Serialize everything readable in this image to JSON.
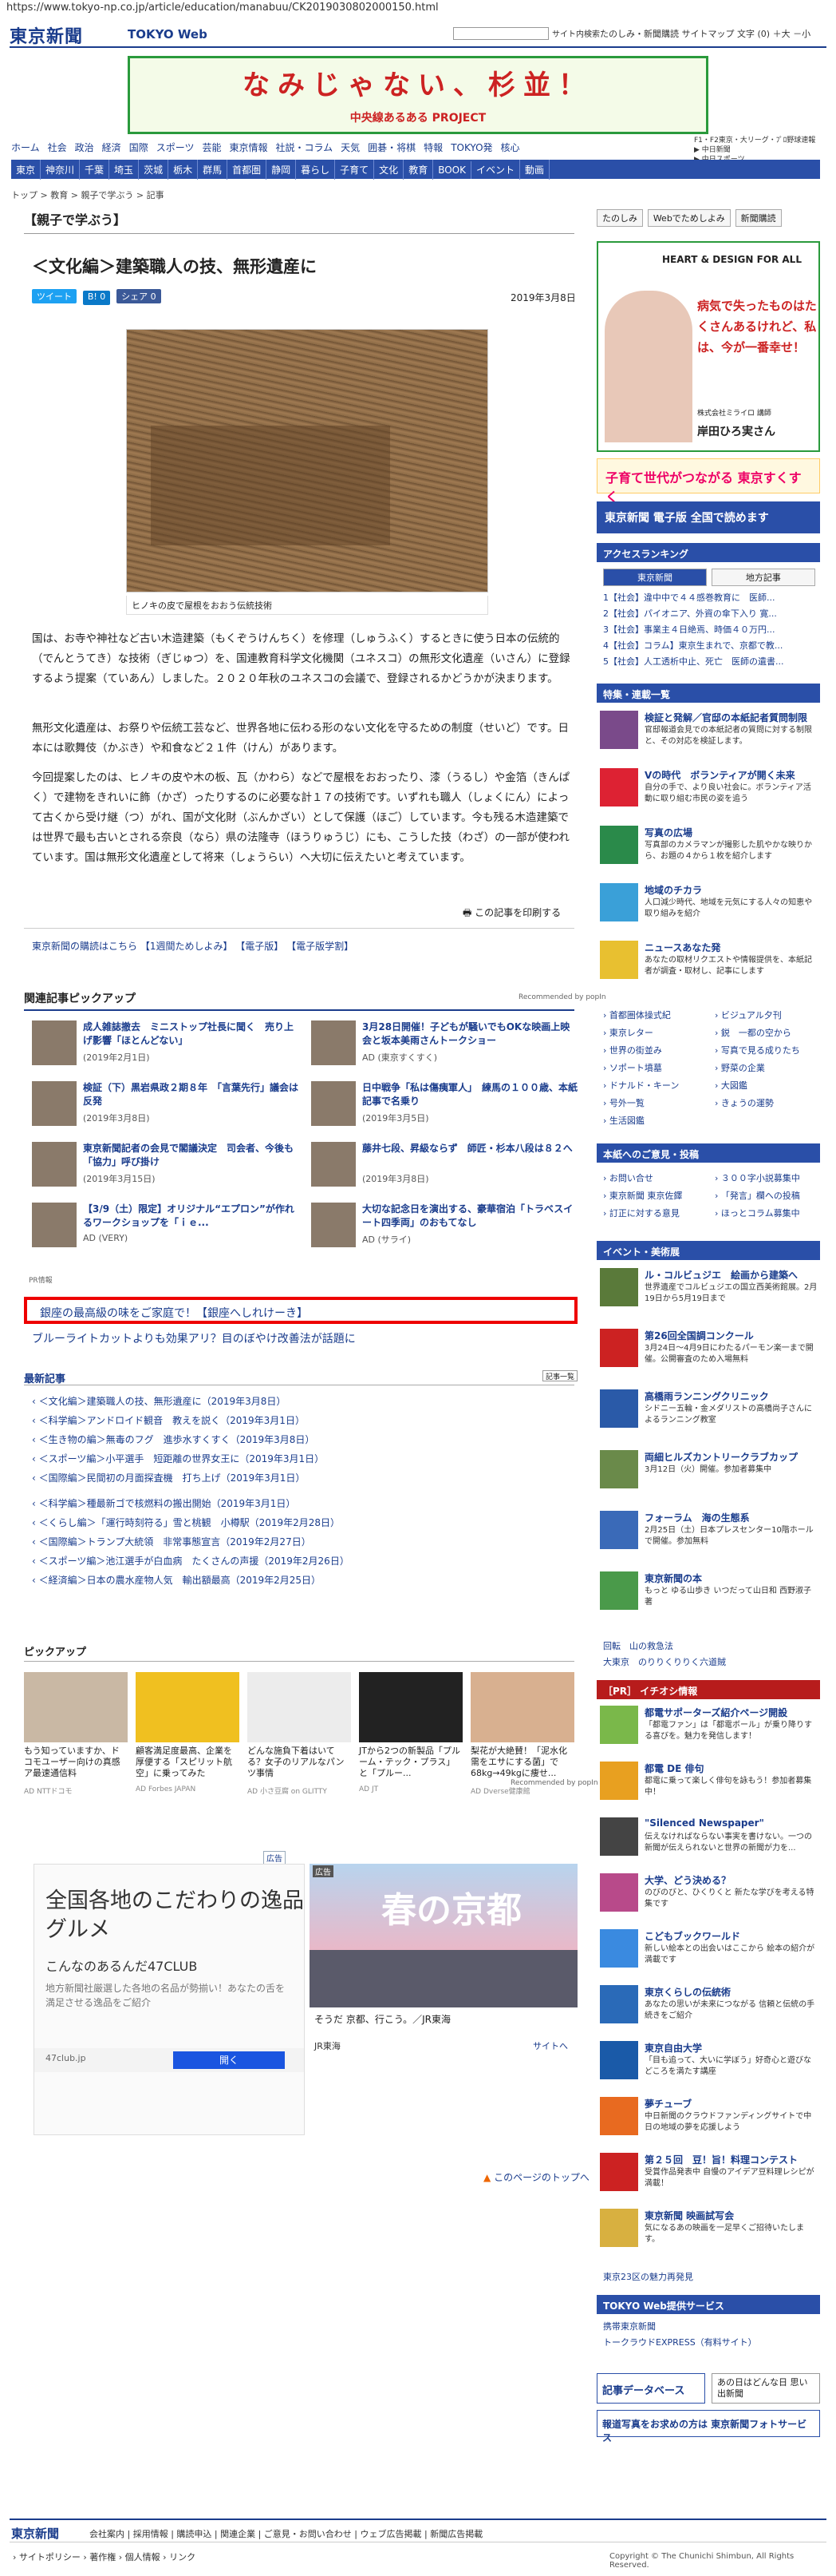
{
  "url": "https://www.tokyo-np.co.jp/article/education/manabuu/CK2019030802000150.html",
  "header": {
    "logo": "東京新聞",
    "logo2": "TOKYO Web",
    "search_btn": "サイト内検索",
    "links": "たのしみ・新聞購読 サイトマップ 文字 (0) ＋大 －小"
  },
  "banner": {
    "title": "なみじゃない、杉並！",
    "sub": "中央線あるある PROJECT"
  },
  "nav1": [
    "ホーム",
    "社会",
    "政治",
    "経済",
    "国際",
    "スポーツ",
    "芸能",
    "東京情報",
    "社説・コラム",
    "天気",
    "囲碁・将棋",
    "特報",
    "TOKYO発",
    "核心"
  ],
  "nav_right": [
    "F1・F2東京・大リーグ・ﾌﾟﾛ野球速報",
    "▶ 中日新聞",
    "▶ 中日スポーツ"
  ],
  "nav2": [
    "東京",
    "神奈川",
    "千葉",
    "埼玉",
    "茨城",
    "栃木",
    "群馬",
    "首都圏",
    "静岡",
    "暮らし",
    "子育て",
    "文化",
    "教育",
    "BOOK",
    "イベント",
    "動画"
  ],
  "crumb": "トップ > 教育 > 親子で学ぶう > 記事",
  "section": "【親子で学ぶう】",
  "article": {
    "title": "＜文化編＞建築職人の技、無形遺産に",
    "share": [
      "ツイート",
      "B! 0",
      "シェア 0"
    ],
    "date": "2019年3月8日",
    "caption": "ヒノキの皮で屋根をおおう伝統技術",
    "p1": "国は、お寺や神社など古い木造建築（もくぞうけんちく）を修理（しゅうふく）するときに使う日本の伝統的（でんとうてき）な技術（ぎじゅつ）を、国連教育科学文化機関（ユネスコ）の無形文化遺産（いさん）に登録するよう提案（ていあん）しました。２０２０年秋のユネスコの会議で、登録されるかどうかが決まります。",
    "p2": "無形文化遺産は、お祭りや伝統工芸など、世界各地に伝わる形のない文化を守るための制度（せいど）です。日本には歌舞伎（かぶき）や和食など２１件（けん）があります。",
    "p3": "今回提案したのは、ヒノキの皮や木の板、瓦（かわら）などで屋根をおおったり、漆（うるし）や金箔（きんぱく）で建物をきれいに飾（かざ）ったりするのに必要な計１７の技術です。いずれも職人（しょくにん）によって古くから受け継（つ）がれ、国が文化財（ぶんかざい）として保護（ほご）しています。今も残る木造建築では世界で最も古いとされる奈良（なら）県の法隆寺（ほうりゅうじ）にも、こうした技（わざ）の一部が使われています。国は無形文化遺産として将来（しょうらい）へ大切に伝えたいと考えています。",
    "more": "この記事を印刷する"
  },
  "links_row": "東京新聞の購読はこちら 【1週間ためしよみ】 【電子版】 【電子版学割】",
  "pick": {
    "title": "関連記事ピックアップ",
    "popin": "Recommended by popIn",
    "items": [
      {
        "t": "成人雑誌撤去　ミニストップ社長に聞く　売り上げ影響「ほとんどない」",
        "d": "(2019年2月1日)"
      },
      {
        "t": "3月28日開催！子どもが騒いでもOKな映画上映会と坂本美雨さんトークショー",
        "d": "AD (東京すくすく)"
      },
      {
        "t": "検証（下）黒岩県政２期８年　「言葉先行」議会は反発",
        "d": "(2019年3月8日)"
      },
      {
        "t": "日中戦争「私は傷痍軍人」　練馬の１００歳、本紙記事で名乗り",
        "d": "(2019年3月5日)"
      },
      {
        "t": "東京新聞記者の会見で閣議決定　司会者、今後も「協力」呼び掛け",
        "d": "(2019年3月15日)"
      },
      {
        "t": "藤井七段、昇級ならず　師匠・杉本八段は８２へ",
        "d": "(2019年3月8日)"
      },
      {
        "t": "【3/9（土）限定】オリジナル“エプロン”が作れるワークショップを「ｉｅ...",
        "d": "AD (VERY)"
      },
      {
        "t": "大切な記念日を演出する、豪華宿泊「トラベスイート四季両」のおもてなし",
        "d": "AD (サライ)"
      }
    ]
  },
  "pr": {
    "tag": "PR情報",
    "main": "銀座の最高級の味をご家庭で！【銀座へしれけーき】",
    "blue": "ブルーライトカットよりも効果アリ？目のぼやけ改善法が話題に"
  },
  "latest": {
    "title": "最新記事",
    "btn": "記事一覧",
    "items": [
      "＜文化編＞建築職人の技、無形遺産に（2019年3月8日）",
      "＜科学編＞アンドロイド観音　教えを説く（2019年3月1日）",
      "＜生き物の編＞無毒のフグ　進歩水すくすく（2019年3月8日）",
      "＜スポーツ編＞小平選手　短距離の世界女王に（2019年3月1日）",
      "＜国際編＞民間初の月面探査機　打ち上げ（2019年3月1日）",
      "＜科学編＞種最新ゴで核燃料の搬出開始（2019年3月1日）",
      "＜くらし編＞「運行時刻符る」雪と桃観　小樽駅（2019年2月28日）",
      "＜国際編＞トランプ大統領　非常事態宣言（2019年2月27日）",
      "＜スポーツ編＞池江選手が白血病　たくさんの声援（2019年2月26日）",
      "＜経済編＞日本の農水産物人気　輸出額最高（2019年2月25日）"
    ]
  },
  "pickup2": {
    "title": "ピックアップ",
    "popin": "Recommended by popIn",
    "items": [
      {
        "t": "もう知っていますか、ドコモユーザー向けの真感ア最速通信料",
        "s": "AD NTTドコモ"
      },
      {
        "t": "顧客満足度最高、企業を厚便する「スピリット航空」に乗ってみた",
        "s": "AD Forbes JAPAN"
      },
      {
        "t": "どんな施負下着はいてる？女子のリアルなパンツ事情",
        "s": "AD 小さ豆腐 on GLITTY"
      },
      {
        "t": "JTから2つの新製品「プルーム・テック・プラス」と「プルー...",
        "s": "AD JT"
      },
      {
        "t": "梨花が大絶賛！「泥水化需をエサにする菌」で68kg→49kgに痩せ...",
        "s": "AD Dverse健康館"
      }
    ]
  },
  "adL": {
    "tag": "広告",
    "h": "全国各地のこだわりの逸品グルメ",
    "s1": "こんなのあるんだ47CLUB",
    "s2": "地方新聞社厳選した各地の名品が勢揃い！あなたの舌を満足させる逸品をご紹介",
    "src": "47club.jp",
    "btn": "開く"
  },
  "adR": {
    "tag": "広告",
    "h": "春の京都",
    "s": "そうだ 京都、行こう。／JR東海",
    "src": "JR東海",
    "site": "サイトへ"
  },
  "pagetop": "このページのトップへ",
  "side": {
    "tabs": [
      "たのしみ",
      "Webでためしよみ",
      "新聞購読"
    ],
    "ad1": {
      "title": "HEART & DESIGN FOR ALL",
      "t": "病気で失ったものはたくさんあるけれど、私は、今が一番幸せ！",
      "s": "株式会社ミライロ 講師",
      "n": "岸田ひろ実さん"
    },
    "ad2": "子育て世代がつながる 東京すくすく",
    "ad3": "東京新聞 電子版 全国で読めます",
    "rank": {
      "title": "アクセスランキング",
      "tabs": [
        "東京新聞",
        "地方記事"
      ],
      "items": [
        "1【社会】違中中で４４感巻教育に　医師...",
        "2【社会】パイオニア、外資の傘下入り 寛...",
        "3【社会】事業主４日絶焉、時価４０万円...",
        "4【社会】コラム】東京生まれで、京都で教...",
        "5【社会】人工透析中止、死亡　医師の遺書..."
      ]
    },
    "feature": {
      "title": "特集・連載一覧",
      "items": [
        {
          "t": "検証と発解／官邸の本紙記者質問制限",
          "d": "官邸報道会見での本紙記者の質問に対する制限と、その対応を検証します。"
        },
        {
          "t": "Vの時代　ボランティアが開く未来",
          "d": "自分の手で、より良い社会に。ボランティア活動に取り組む市民の姿を追う"
        },
        {
          "t": "写真の広場",
          "d": "写真部のカメラマンが撮影した肌やかな映りから、お題の４から１枚を紹介します"
        },
        {
          "t": "地域のチカラ",
          "d": "人口減少時代、地域を元気にする人々の知恵や取り組みを紹介"
        },
        {
          "t": "ニュースあなた発",
          "d": "あなたの取材リクエストや情報提供を、本紙記者が調査・取材し、記事にします"
        }
      ]
    },
    "col_links": [
      "首都圏体操式紀",
      "ビジュアル夕刊",
      "東京レター",
      "鋭　一都の空から",
      "世界の街並み",
      "写真で見る成りたち",
      "ソポート墳墓",
      "野菜の企業",
      "ドナルド・キーン",
      "大図鑑",
      "号外一覧",
      "きょうの運勢",
      "生活図鑑"
    ],
    "paper": {
      "title": "本紙へのご意見・投稿",
      "links": [
        "お問い合せ",
        "３００字小説募集中",
        "東京新聞 東京佐鐸",
        "「発言」欄への投稿",
        "訂正に対する意見",
        "ほっとコラム募集中"
      ]
    },
    "event": {
      "title": "イベント・美術展",
      "items": [
        {
          "t": "ル・コルビュジエ　絵画から建築へ",
          "d": "世界遺産でコルビュジエの国立西美術館展。2月19日から5月19日まで"
        },
        {
          "t": "第26回全国調コンクール",
          "d": "3月24日～4月9日にわたるパーモン楽一まで開催。公開審査のため入場無料"
        },
        {
          "t": "高橋雨ランニングクリニック",
          "d": "シドニー五輪・金メダリストの高橋尚子さんによるランニング教室"
        },
        {
          "t": "両細ヒルズカントリークラブカップ",
          "d": "3月12日（火）開催。参加者募集中"
        },
        {
          "t": "フォーラム　海の生態系",
          "d": "2月25日（土）日本プレスセンター10階ホールで開催。参加無料"
        },
        {
          "t": "東京新聞の本",
          "d": "もっと ゆる山歩き いつだって山日和 西野淑子 著"
        }
      ]
    },
    "tiny_links": [
      "回転　山の救急法",
      "大東京　のりりくりりく六道賊"
    ],
    "pr_title": "［PR］ イチオシ情報",
    "pr_items": [
      {
        "t": "都電サポーターズ紹介ページ開設",
        "d": "「都電ファン」は「都電ボール」が乗り降りする喜びを。魅力を発信します！"
      },
      {
        "t": "都電 DE 俳句",
        "d": "都電に乗って楽しく俳句を詠もう！参加者募集中！"
      },
      {
        "t": "\"Silenced Newspaper\"",
        "d": "伝えなければならない事実を書けない。一つの新聞が伝えられないと世界の新聞が力を..."
      },
      {
        "t": "大学、どう決める？",
        "d": "のびのびと、ひくりくと 新たな学びを考える特集です"
      },
      {
        "t": "こどもブックワールド",
        "d": "新しい絵本との出会いはここから 絵本の紹介が満載です"
      },
      {
        "t": "東京くらしの伝統術",
        "d": "あなたの思いが未来につながる 信頼と伝統の手続きをご紹介"
      },
      {
        "t": "東京自由大学",
        "d": "「目も追って、大いに学ぼう」好奇心と遊びなどころを満たす講座"
      },
      {
        "t": "夢チューブ",
        "d": "中日新聞のクラウドファンディングサイトで中日の地域の夢を応援しよう"
      },
      {
        "t": "第２５回　豆！旨！料理コンテスト",
        "d": "受賞作品発表中 自慢のアイデア豆料理レシピが満載！"
      },
      {
        "t": "東京新聞 映画試写会",
        "d": "気になるあの映画を一足早くご招待いたします。"
      }
    ],
    "link23": "東京23区の魅力再発見",
    "service": {
      "title": "TOKYO Web提供サービス",
      "links": [
        "携帯東京新聞",
        "トークラウドEXPRESS（有料サイト）"
      ]
    },
    "bottom_banners": [
      "記事データベース",
      "あの日はどんな日 思い出新聞",
      "報道写真をお求めの方は 東京新聞フォトサービス"
    ]
  },
  "footer": {
    "logo": "東京新聞",
    "links": "会社案内 | 採用情報 | 購読申込 | 関連企業 | ご意見・お問い合わせ | ウェブ広告掲載 | 新聞広告掲載",
    "links2": "› サイトポリシー › 著作権 › 個人情報 › リンク",
    "copy": "Copyright © The Chunichi Shimbun, All Rights Reserved."
  }
}
